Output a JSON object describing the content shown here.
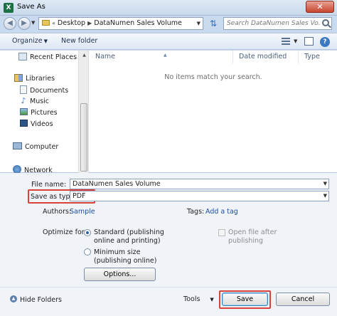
{
  "window": {
    "title": "Save As",
    "app_icon_glyph": "X",
    "close_glyph": "✕"
  },
  "address": {
    "back_glyph": "◀",
    "forward_glyph": "▶",
    "separator": "«",
    "crumbs": [
      "Desktop",
      "DataNumen Sales Volume"
    ],
    "crumb_arrow": "▶",
    "refresh_glyph": "⇅",
    "search_placeholder": "Search DataNumen Sales Vo..."
  },
  "toolbar": {
    "organize_label": "Organize",
    "new_folder_label": "New folder",
    "help_glyph": "?"
  },
  "nav": {
    "recent": "Recent Places",
    "libraries": "Libraries",
    "documents": "Documents",
    "music": "Music",
    "pictures": "Pictures",
    "videos": "Videos",
    "computer": "Computer",
    "network": "Network"
  },
  "list": {
    "columns": [
      "Name",
      "Date modified",
      "Type"
    ],
    "empty_message": "No items match your search."
  },
  "form": {
    "file_name_label": "File name:",
    "file_name_value": "DataNumen Sales Volume",
    "save_type_label": "Save as type:",
    "save_type_value": "PDF",
    "authors_label": "Authors:",
    "authors_value": "Sample",
    "tags_label": "Tags:",
    "tags_value": "Add a tag",
    "optimize_label": "Optimize for:",
    "standard_line1": "Standard (publishing",
    "standard_line2": "online and printing)",
    "minimum_line1": "Minimum size",
    "minimum_line2": "(publishing online)",
    "open_after_line1": "Open file after",
    "open_after_line2": "publishing",
    "options_label": "Options...",
    "optimize_selected": "standard",
    "open_after_checked": false
  },
  "footer": {
    "hide_folders_label": "Hide Folders",
    "tools_label": "Tools",
    "save_label": "Save",
    "cancel_label": "Cancel"
  },
  "colors": {
    "highlight": "#d9413b",
    "link": "#1c4ea0",
    "chrome": "#c9d9ee"
  }
}
